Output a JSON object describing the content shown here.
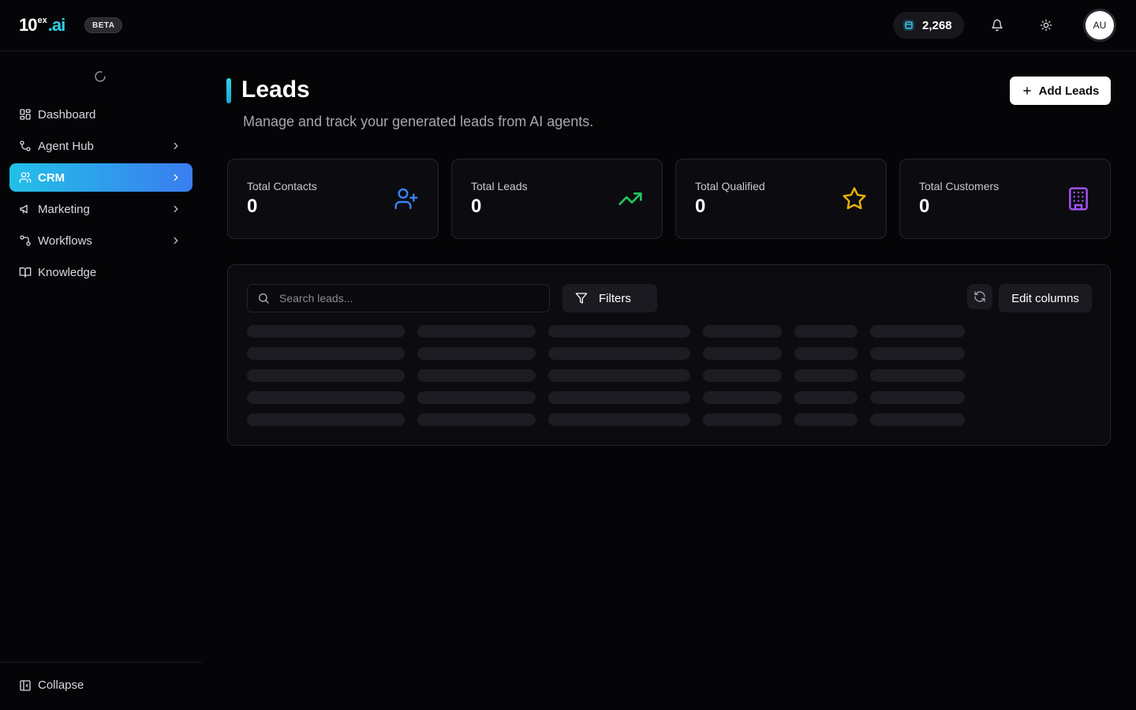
{
  "header": {
    "logo_main": "10",
    "logo_sup": "ex",
    "logo_suffix": ".ai",
    "beta_label": "BETA",
    "credits": "2,268",
    "avatar_initials": "AU"
  },
  "sidebar": {
    "items": [
      {
        "label": "Dashboard",
        "icon": "dashboard-grid-icon",
        "has_chevron": false,
        "active": false
      },
      {
        "label": "Agent Hub",
        "icon": "agent-hub-icon",
        "has_chevron": true,
        "active": false
      },
      {
        "label": "CRM",
        "icon": "users-icon",
        "has_chevron": true,
        "active": true
      },
      {
        "label": "Marketing",
        "icon": "megaphone-icon",
        "has_chevron": true,
        "active": false
      },
      {
        "label": "Workflows",
        "icon": "workflow-icon",
        "has_chevron": true,
        "active": false
      },
      {
        "label": "Knowledge",
        "icon": "book-icon",
        "has_chevron": false,
        "active": false
      }
    ],
    "collapse_label": "Collapse"
  },
  "main": {
    "title": "Leads",
    "subtitle": "Manage and track your generated leads from AI agents.",
    "add_button_label": "Add Leads",
    "stats": [
      {
        "label": "Total Contacts",
        "value": "0",
        "icon": "user-plus-icon",
        "color": "#3b82f6"
      },
      {
        "label": "Total Leads",
        "value": "0",
        "icon": "trending-up-icon",
        "color": "#22c55e"
      },
      {
        "label": "Total Qualified",
        "value": "0",
        "icon": "star-icon",
        "color": "#eab308"
      },
      {
        "label": "Total Customers",
        "value": "0",
        "icon": "building-icon",
        "color": "#a855f7"
      }
    ],
    "table": {
      "search_placeholder": "Search leads...",
      "filters_label": "Filters",
      "edit_columns_label": "Edit columns",
      "loading": true
    }
  },
  "colors": {
    "accent_start": "#22c0e8",
    "accent_end": "#3a7df0",
    "background": "#050507"
  }
}
